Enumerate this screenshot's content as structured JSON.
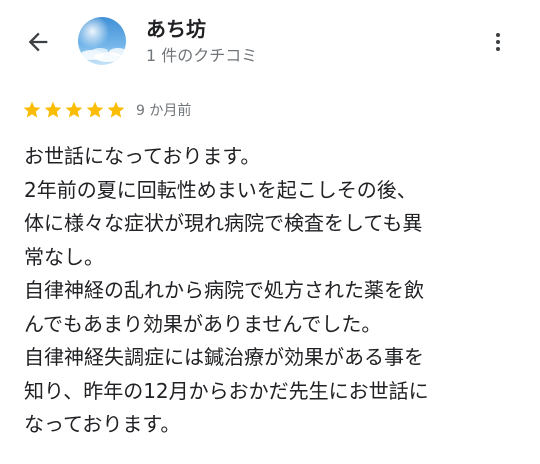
{
  "header": {
    "back_icon": "arrow-back-icon",
    "reviewer_name": "あち坊",
    "reviewer_review_count": "1 件のクチコミ",
    "avatar": "sky-avatar",
    "more_icon": "more-vert-icon"
  },
  "review": {
    "rating": 5,
    "rating_max": 5,
    "star_color": "#fbbc04",
    "time_ago": "9 か月前",
    "lines": [
      "お世話になっております。",
      "2年前の夏に回転性めまいを起こしその後、",
      "体に様々な症状が現れ病院で検査をしても異",
      "常なし。",
      "自律神経の乱れから病院で処方された薬を飲",
      "んでもあまり効果がありませんでした。",
      "自律神経失調症には鍼治療が効果がある事を",
      "知り、昨年の12月からおかだ先生にお世話に",
      "なっております。"
    ]
  }
}
